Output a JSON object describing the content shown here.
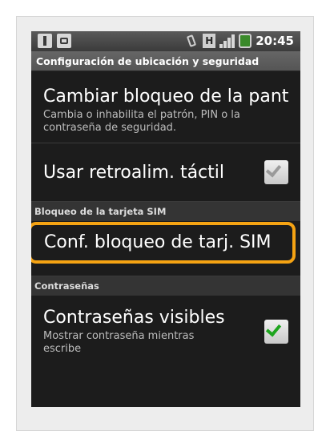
{
  "statusbar": {
    "time": "20:45",
    "icons": [
      "usb-icon",
      "bag-icon",
      "vibrate-icon",
      "hsdpa-icon",
      "signal-icon",
      "battery-icon"
    ],
    "network_label": "H"
  },
  "titlebar": {
    "title": "Configuración de ubicación y seguridad"
  },
  "items": {
    "change_lock": {
      "title": "Cambiar bloqueo de la pantalla",
      "summary": "Cambia o inhabilita el patrón, PIN o la contraseña de seguridad."
    },
    "haptic": {
      "title": "Usar retroalim. táctil",
      "checked": false
    },
    "sim_lock": {
      "title": "Conf. bloqueo de tarj. SIM"
    },
    "visible_passwords": {
      "title": "Contraseñas visibles",
      "summary": "Mostrar contraseña mientras escribe",
      "checked": true
    }
  },
  "sections": {
    "sim": "Bloqueo de la tarjeta SIM",
    "passwords": "Contraseñas"
  },
  "colors": {
    "highlight": "#f5a313",
    "check_on": "#1ea51e"
  }
}
